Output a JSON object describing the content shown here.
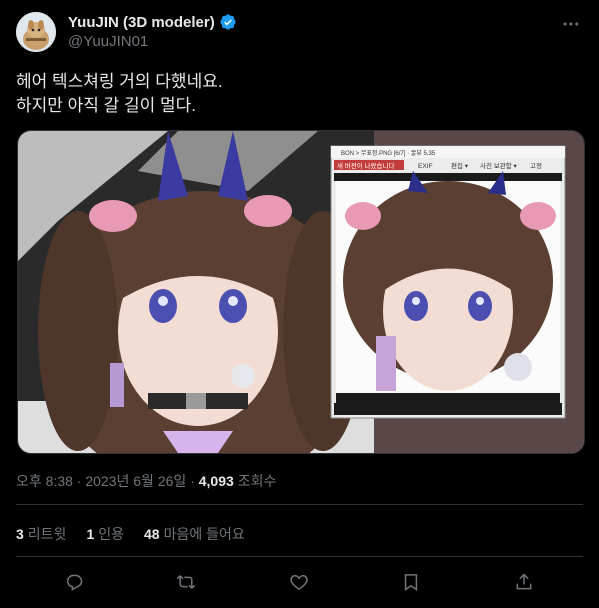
{
  "author": {
    "display_name": "YuuJIN (3D modeler)",
    "handle": "@YuuJIN01",
    "verified": true
  },
  "tweet": {
    "text": "헤어 텍스쳐링 거의 다했네요.\n하지만 아직 갈 길이 멀다."
  },
  "media": {
    "viewer": {
      "title": "BON > 무표정.PNG [6/7] · 꿀뷰 5.35",
      "notice_button": "새 버전이 나왔습니다",
      "exif_label": "EXIF",
      "menu_edit": "편집 ▾",
      "menu_photo": "사진 보관함 ▾",
      "menu_highlight": "고정"
    }
  },
  "meta": {
    "time": "오후 8:38",
    "date": "2023년 6월 26일",
    "views_count": "4,093",
    "views_label": "조회수",
    "separator": "·"
  },
  "stats": {
    "retweets_count": "3",
    "retweets_label": "리트윗",
    "quotes_count": "1",
    "quotes_label": "인용",
    "likes_count": "48",
    "likes_label": "마음에 들어요"
  },
  "icons": {
    "reply": "reply-icon",
    "retweet": "retweet-icon",
    "like": "heart-icon",
    "bookmark": "bookmark-icon",
    "share": "share-icon",
    "more": "more-icon",
    "verified": "verified-badge-icon"
  },
  "colors": {
    "background": "#000000",
    "text_primary": "#e7e9ea",
    "text_secondary": "#71767b",
    "verified_blue": "#1d9bf0",
    "divider": "#2f3336"
  }
}
